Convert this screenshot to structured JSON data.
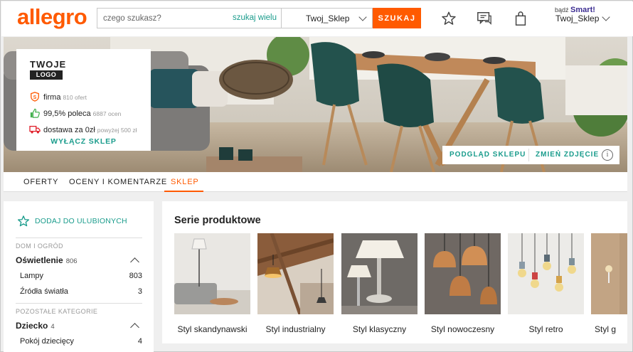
{
  "header": {
    "logo": "allegro",
    "search_placeholder": "czego szukasz?",
    "search_many": "szukaj wielu",
    "store_select": "Twoj_Sklep",
    "search_button": "SZUKAJ",
    "smart_prefix": "bądź",
    "smart_brand": "Smart!",
    "username": "Twoj_Sklep",
    "icons": [
      "star-icon",
      "chat-icon",
      "bag-icon",
      "chevron-down-icon"
    ],
    "accent_color": "#ff5a00"
  },
  "store_card": {
    "logo_top": "TWOJE",
    "logo_bottom": "LOGO",
    "company_label": "firma",
    "company_sub": "810 ofert",
    "recommend_label": "99,5% poleca",
    "recommend_sub": "6887 ocen",
    "delivery_label": "dostawa za 0zł",
    "delivery_sub": "powyżej 500 zł",
    "turn_off": "WYŁĄCZ SKLEP"
  },
  "banner_actions": {
    "preview": "PODGLĄD SKLEPU",
    "change_photo": "ZMIEŃ ZDJĘCIE",
    "info": "i"
  },
  "tabs": [
    {
      "label": "OFERTY"
    },
    {
      "label": "OCENY I KOMENTARZE"
    },
    {
      "label": "SKLEP"
    }
  ],
  "sidebar": {
    "favorite": "DODAJ DO ULUBIONYCH",
    "group1": "DOM I OGRÓD",
    "cat1": {
      "label": "Oświetlenie",
      "count": "806"
    },
    "cat1_items": [
      {
        "label": "Lampy",
        "count": "803"
      },
      {
        "label": "Źródła światła",
        "count": "3"
      }
    ],
    "group2": "POZOSTAŁE KATEGORIE",
    "cat2": {
      "label": "Dziecko",
      "count": "4"
    },
    "cat2_items": [
      {
        "label": "Pokój dziecięcy",
        "count": "4"
      }
    ]
  },
  "main": {
    "title": "Serie produktowe",
    "tiles": [
      {
        "label": "Styl skandynawski"
      },
      {
        "label": "Styl industrialny"
      },
      {
        "label": "Styl klasyczny"
      },
      {
        "label": "Styl nowoczesny"
      },
      {
        "label": "Styl retro"
      },
      {
        "label": "Styl g"
      }
    ]
  }
}
